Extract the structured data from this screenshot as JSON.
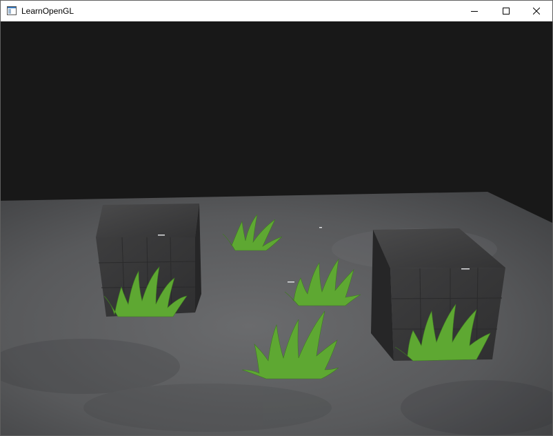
{
  "window": {
    "title": "LearnOpenGL",
    "icon": "app-window-icon",
    "controls": [
      "minimize-icon",
      "maximize-icon",
      "close-icon"
    ]
  },
  "scene": {
    "clear_color": "#181818",
    "floor_color": "#5a5b5d",
    "cube_color": "#3b3b3c",
    "grass_color": "#5ea832",
    "objects": [
      "floor",
      "cube",
      "cube",
      "grass",
      "grass",
      "grass",
      "grass",
      "grass"
    ]
  }
}
